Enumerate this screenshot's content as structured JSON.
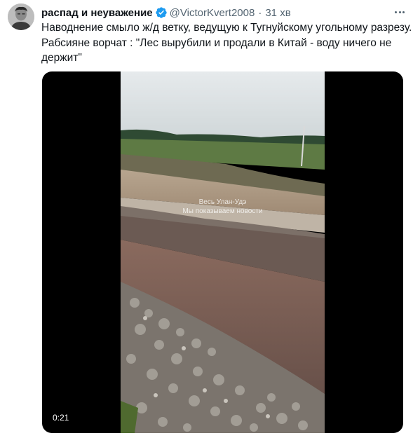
{
  "tweet": {
    "display_name": "распад и неуважение",
    "handle": "@VictorKvert2008",
    "separator": "·",
    "time": "31 хв",
    "text_lines": [
      "Наводнение смыло ж/д ветку, ведущую к Тугнуйскому угольному разрезу.",
      "Рабсияне ворчат : \"Лес вырубили и продали в Китай - воду ничего не",
      "держит\""
    ],
    "avatar_icon": "avatar-photo",
    "verified_icon": "verified-badge-icon",
    "more_icon": "more-options-icon"
  },
  "video": {
    "duration": "0:21",
    "watermark_line1": "Весь Улан-Удэ",
    "watermark_line2": "Мы показываем новости"
  },
  "colors": {
    "verified": "#1d9bf0",
    "text_primary": "#0f1419",
    "text_secondary": "#536471"
  }
}
